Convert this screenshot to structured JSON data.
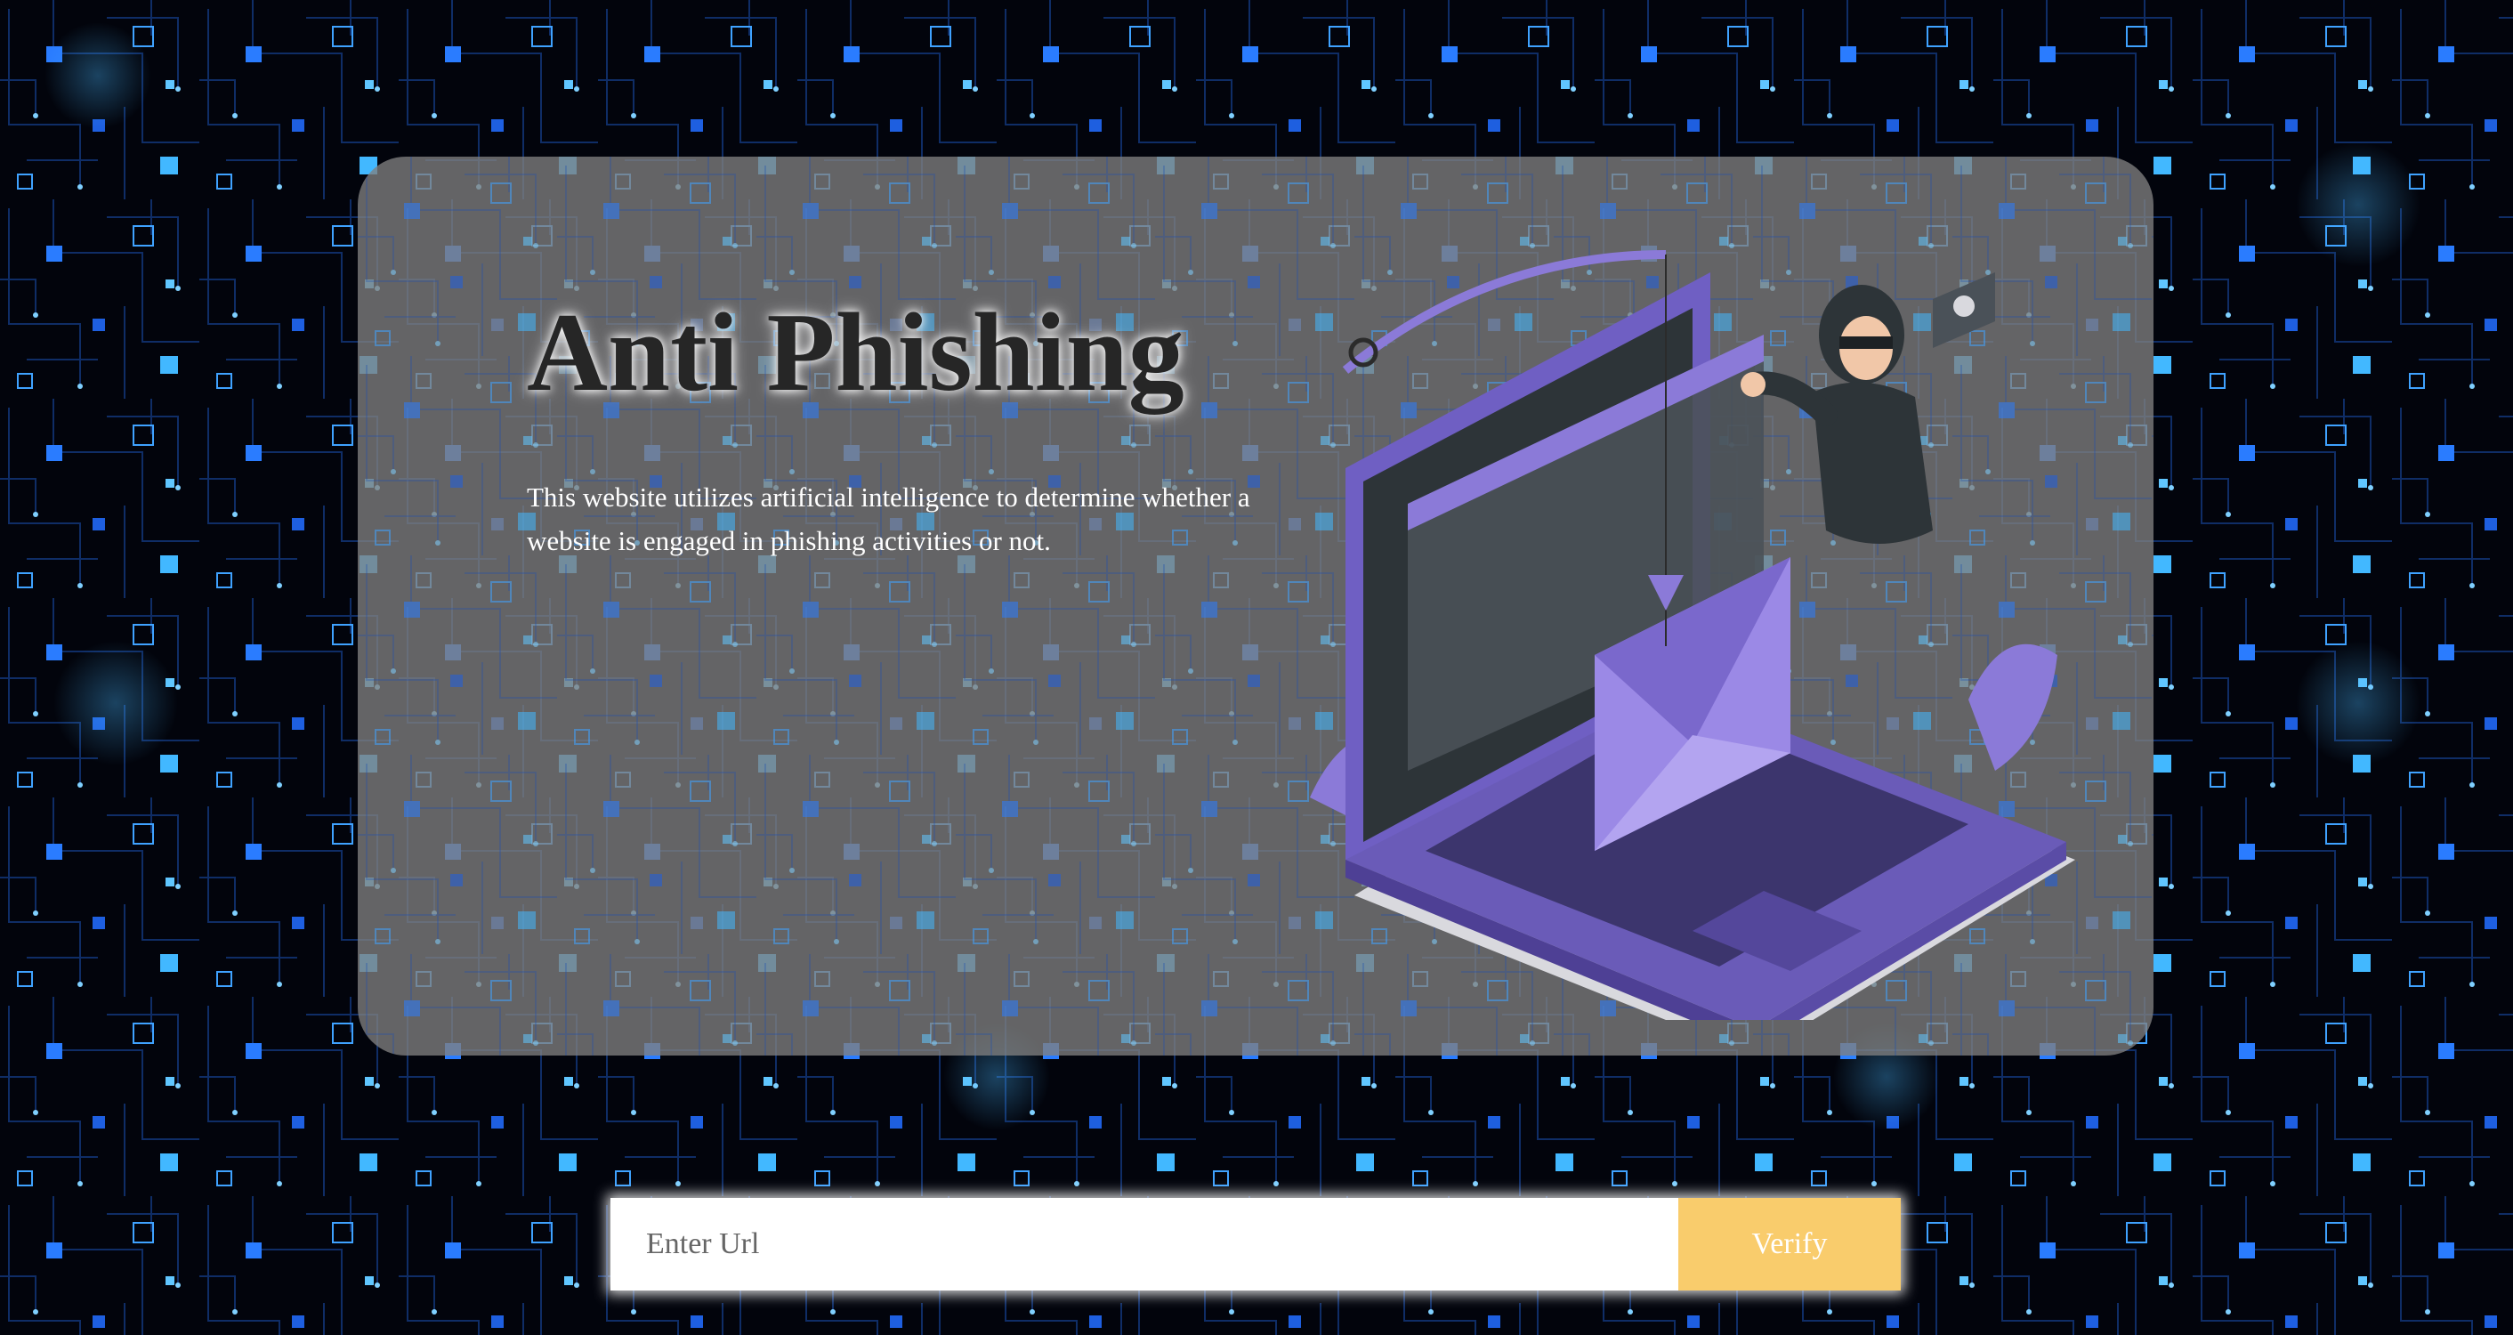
{
  "hero": {
    "title": "Anti Phishing",
    "description": "This website utilizes artificial intelligence to determine whether a website is engaged in phishing activities or not."
  },
  "url_form": {
    "placeholder": "Enter Url",
    "value": "",
    "verify_label": "Verify"
  },
  "illustration": {
    "icon": "hacker-laptop-phishing-illustration",
    "accent_color": "#8b7ad8"
  },
  "theme": {
    "background": "#02040c",
    "circuit_color": "#2f8fff",
    "card_color": "#808080",
    "button_color": "#f9cc6c"
  }
}
